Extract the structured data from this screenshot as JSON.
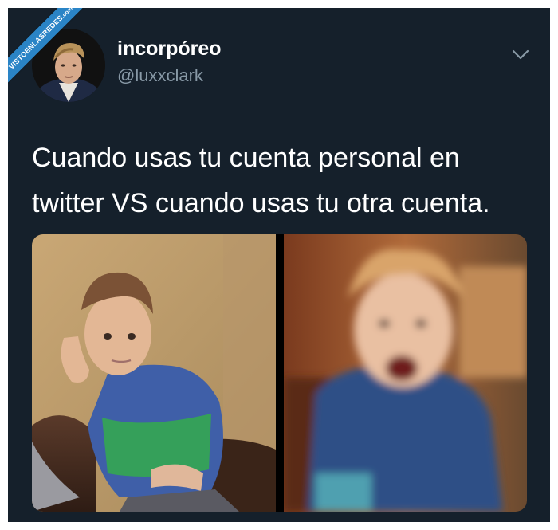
{
  "watermark": {
    "text": "VISTOENLASREDES",
    "sub": ".com"
  },
  "tweet": {
    "author": {
      "display_name": "incorpóreo",
      "handle": "@luxxclark"
    },
    "menu_icon": "chevron-down-icon",
    "text_lines": [
      "Cuando usas tu cuenta personal en",
      "twitter VS cuando usas tu otra cuenta."
    ],
    "media": [
      {
        "description_icon": "photo-calm-boy"
      },
      {
        "description_icon": "photo-screaming-boy"
      }
    ]
  },
  "colors": {
    "background": "#15202b",
    "name": "#ffffff",
    "handle": "#8899a6",
    "ribbon": "#2a84c6"
  }
}
